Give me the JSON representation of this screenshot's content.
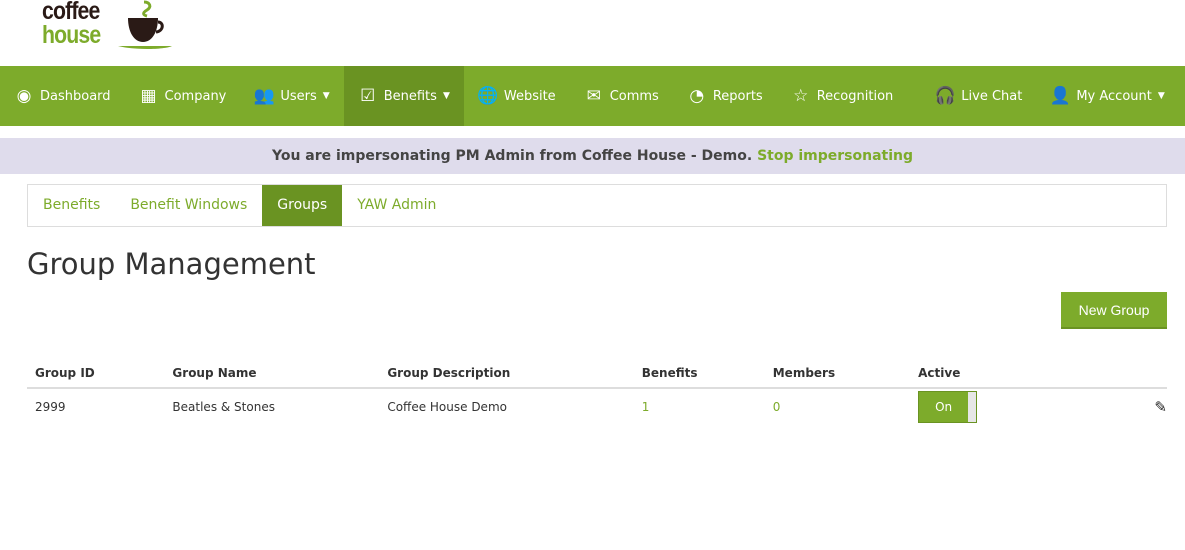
{
  "logo": {
    "line1": "coffee",
    "line2": "house"
  },
  "nav": [
    {
      "label": "Dashboard",
      "icon": "dashboard-icon",
      "glyph": "◉"
    },
    {
      "label": "Company",
      "icon": "building-icon",
      "glyph": "▦"
    },
    {
      "label": "Users",
      "icon": "users-icon",
      "glyph": "👥",
      "caret": true
    },
    {
      "label": "Benefits",
      "icon": "checkbox-icon",
      "glyph": "☑",
      "caret": true,
      "active": true
    },
    {
      "label": "Website",
      "icon": "globe-icon",
      "glyph": "🌐"
    },
    {
      "label": "Comms",
      "icon": "mail-icon",
      "glyph": "✉"
    },
    {
      "label": "Reports",
      "icon": "pie-chart-icon",
      "glyph": "◔"
    },
    {
      "label": "Recognition",
      "icon": "star-icon",
      "glyph": "☆"
    },
    {
      "label": "Live Chat",
      "icon": "headset-icon",
      "glyph": "🎧"
    },
    {
      "label": "My Account",
      "icon": "user-icon",
      "glyph": "👤",
      "caret": true
    }
  ],
  "banner": {
    "text": "You are impersonating PM Admin from Coffee House - Demo.",
    "link": "Stop impersonating"
  },
  "subtabs": [
    "Benefits",
    "Benefit Windows",
    "Groups",
    "YAW Admin"
  ],
  "active_subtab": 2,
  "page_title": "Group Management",
  "new_group_label": "New Group",
  "table": {
    "headers": [
      "Group ID",
      "Group Name",
      "Group Description",
      "Benefits",
      "Members",
      "Active",
      ""
    ],
    "rows": [
      {
        "id": "2999",
        "name": "Beatles & Stones",
        "description": "Coffee House Demo",
        "benefits": "1",
        "members": "0",
        "active": "On"
      }
    ]
  }
}
